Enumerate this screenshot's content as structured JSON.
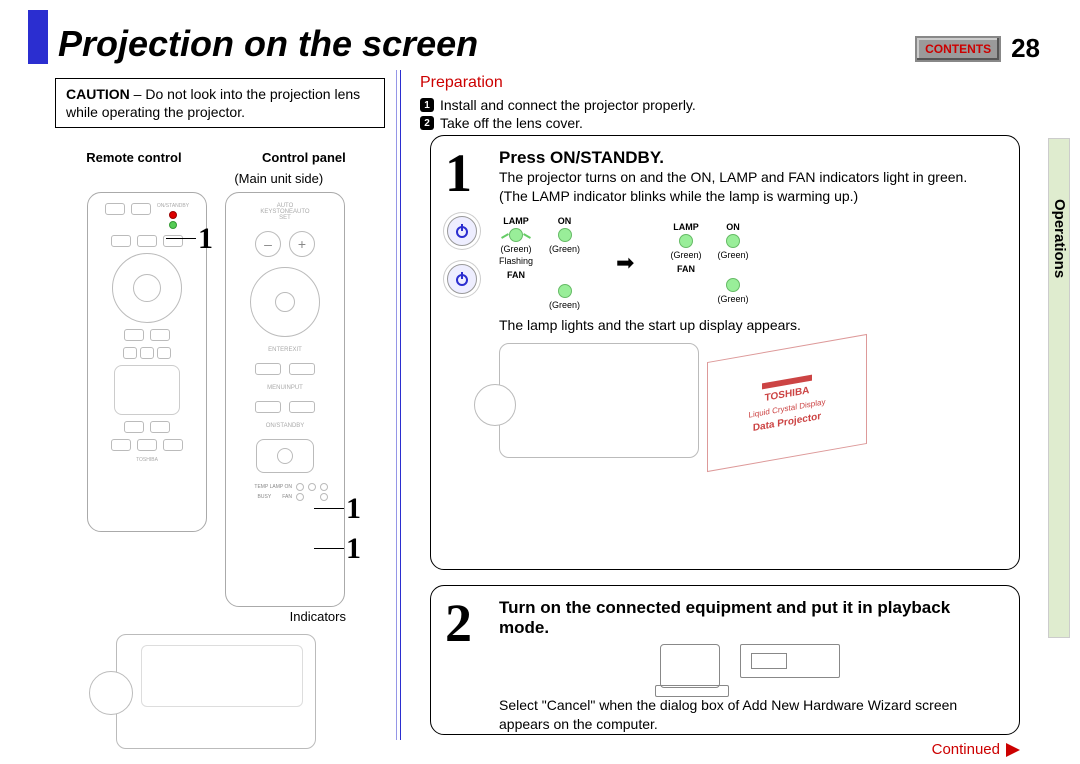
{
  "header": {
    "title": "Projection on the screen",
    "contents_label": "CONTENTS",
    "page_number": "28"
  },
  "side_tab": "Operations",
  "caution": {
    "label": "CAUTION",
    "text": " – Do not look into the projection lens while operating the projector."
  },
  "preparation": {
    "title": "Preparation",
    "items": [
      "Install and connect the projector properly.",
      "Take off the lens cover."
    ]
  },
  "left": {
    "remote_label": "Remote control",
    "panel_label": "Control panel",
    "panel_sub": "(Main unit side)",
    "indicators_label": "Indicators",
    "callout": "1"
  },
  "step1": {
    "num": "1",
    "title": "Press ON/STANDBY.",
    "line1": "The projector turns on and the ON, LAMP and FAN indicators light in green.",
    "line2": "(The LAMP indicator blinks while the lamp is warming up.)",
    "line3": "The lamp lights and the start up display appears.",
    "indicators": {
      "lamp": "LAMP",
      "on": "ON",
      "fan": "FAN",
      "green": "(Green)",
      "flashing": "Flashing"
    },
    "screen": {
      "brand": "TOSHIBA",
      "sub": "Liquid Crystal Display",
      "main": "Data Projector"
    }
  },
  "step2": {
    "num": "2",
    "title": "Turn on the connected equipment and put it in playback mode.",
    "note": "Select \"Cancel\" when the dialog box of Add New Hardware Wizard screen appears on the computer."
  },
  "continued": "Continued"
}
